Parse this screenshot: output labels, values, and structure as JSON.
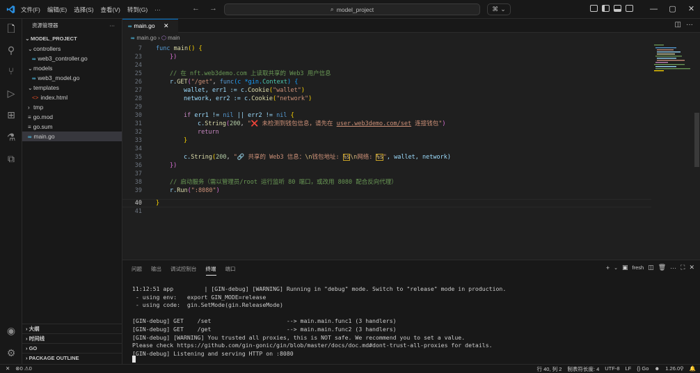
{
  "titlebar": {
    "menus": [
      "文件(F)",
      "编辑(E)",
      "选择(S)",
      "查看(V)",
      "转到(G)",
      "···"
    ],
    "search": "model_project",
    "copilot": "⌘"
  },
  "sidebar": {
    "header": "资源管理器",
    "project": "MODEL_PROJECT",
    "items": [
      {
        "label": "controllers",
        "type": "folder"
      },
      {
        "label": "web3_controller.go",
        "type": "go"
      },
      {
        "label": "models",
        "type": "folder"
      },
      {
        "label": "web3_model.go",
        "type": "go"
      },
      {
        "label": "templates",
        "type": "folder"
      },
      {
        "label": "index.html",
        "type": "html"
      },
      {
        "label": "tmp",
        "type": "folder-closed"
      },
      {
        "label": "go.mod",
        "type": "mod"
      },
      {
        "label": "go.sum",
        "type": "mod"
      },
      {
        "label": "main.go",
        "type": "go"
      }
    ],
    "bottom": [
      "大纲",
      "时间线",
      "GO",
      "PACKAGE OUTLINE"
    ]
  },
  "editor": {
    "tab": "main.go",
    "breadcrumb_file": "main.go",
    "breadcrumb_symbol": "main",
    "line_numbers": [
      "7",
      "23",
      "24",
      "25",
      "26",
      "27",
      "28",
      "29",
      "30",
      "31",
      "32",
      "33",
      "34",
      "35",
      "36",
      "37",
      "38",
      "39",
      "40",
      "41"
    ],
    "code": {
      "l7_kw": "func",
      "l7_fn": "main",
      "l7_rest": "() {",
      "l23": "})",
      "l25": "// 在 nft.web3demo.com 上读取共享的 Web3 用户信息",
      "l26_a": "r.",
      "l26_fn": "GET",
      "l26_b": "(",
      "l26_str": "\"/get\"",
      "l26_c": ", ",
      "l26_kw": "func",
      "l26_d": "(c *gin.",
      "l26_tp": "Context",
      "l26_e": ") {",
      "l27_a": "wallet, err1 := c.",
      "l27_fn": "Cookie",
      "l27_str": "\"wallet\"",
      "l28_a": "network, err2 := c.",
      "l28_fn": "Cookie",
      "l28_str": "\"network\"",
      "l30_kw": "if",
      "l30_a": " err1 != ",
      "l30_nil": "nil",
      "l30_b": " || err2 != ",
      "l30_c": " {",
      "l31_a": "c.",
      "l31_fn": "String",
      "l31_num": "200",
      "l31_str": "\"❌ 未检测到钱包信息，请先在 ",
      "l31_url": "user.web3demo.com/set",
      "l31_str2": " 连接钱包\"",
      "l32": "return",
      "l33": "}",
      "l35_a": "c.",
      "l35_fn": "String",
      "l35_num": "200",
      "l35_str1": "\"🔗 共享的 Web3 信息：",
      "l35_esc1": "\\n",
      "l35_str2": "钱包地址: ",
      "l35_esc2": "%s",
      "l35_esc3": "\\n",
      "l35_str3": "网络: ",
      "l35_esc4": "%s",
      "l35_str4": "\"",
      "l35_rest": ", wallet, network)",
      "l36": "})",
      "l38": "// 启动服务（需以管理员/root 运行监听 80 端口，或改用 8080 配合反向代理）",
      "l39_a": "r.",
      "l39_fn": "Run",
      "l39_str": "\":8080\"",
      "l40": "}"
    }
  },
  "panel": {
    "tabs": [
      "问题",
      "输出",
      "调试控制台",
      "终端",
      "端口"
    ],
    "active_tab": "终端",
    "shell": "fresh",
    "terminal": [
      "11:12:51 app         | [GIN-debug] [WARNING] Running in \"debug\" mode. Switch to \"release\" mode in production.",
      " - using env:   export GIN_MODE=release",
      " - using code:  gin.SetMode(gin.ReleaseMode)",
      "",
      "[GIN-debug] GET    /set                      --> main.main.func1 (3 handlers)",
      "[GIN-debug] GET    /get                      --> main.main.func2 (3 handlers)",
      "[GIN-debug] [WARNING] You trusted all proxies, this is NOT safe. We recommend you to set a value.",
      "Please check https://github.com/gin-gonic/gin/blob/master/docs/doc.md#dont-trust-all-proxies for details.",
      "[GIN-debug] Listening and serving HTTP on :8080"
    ]
  },
  "status": {
    "errors": "0",
    "warnings": "0",
    "position": "行 40, 列 2",
    "indent": "制表符长度: 4",
    "encoding": "UTF-8",
    "eol": "LF",
    "language": "Go",
    "version": "1.26.0"
  },
  "colors": {
    "accent": "#0078d4",
    "bg": "#1f1f1f",
    "sidebar": "#181818"
  }
}
